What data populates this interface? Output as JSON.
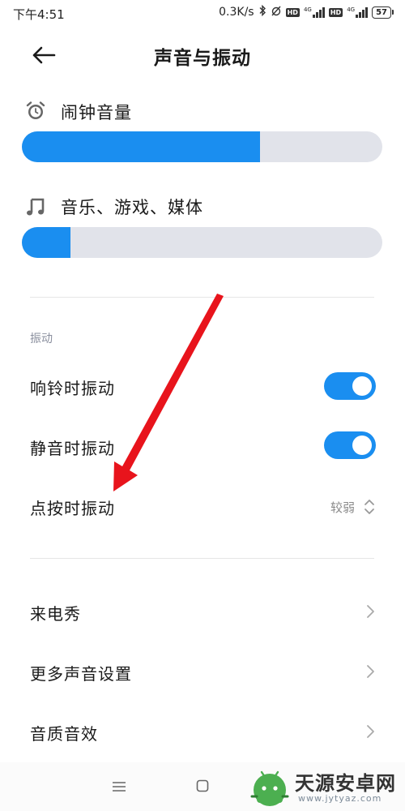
{
  "status_bar": {
    "time": "下午4:51",
    "net_speed": "0.3K/s",
    "hd1": "HD",
    "net1": "4G",
    "hd2": "HD",
    "net2": "4G",
    "battery": "57"
  },
  "header": {
    "back_icon": "arrow-left-icon",
    "title": "声音与振动"
  },
  "volume": [
    {
      "icon": "alarm-clock-icon",
      "label": "闹钟音量",
      "level": 0.66
    },
    {
      "icon": "music-note-icon",
      "label": "音乐、游戏、媒体",
      "level": 0.135
    }
  ],
  "vibration": {
    "section_title": "振动",
    "ring_label": "响铃时振动",
    "ring_on": true,
    "silent_label": "静音时振动",
    "silent_on": true,
    "tap_label": "点按时振动",
    "tap_value": "较弱"
  },
  "more": {
    "items": [
      {
        "label": "来电秀"
      },
      {
        "label": "更多声音设置"
      },
      {
        "label": "音质音效"
      }
    ]
  },
  "watermark": {
    "name": "天源安卓网",
    "url": "www.jytyaz.com"
  },
  "colors": {
    "accent": "#1a8ef0",
    "track": "#e1e3ea",
    "annotation_arrow": "#e8141c"
  }
}
